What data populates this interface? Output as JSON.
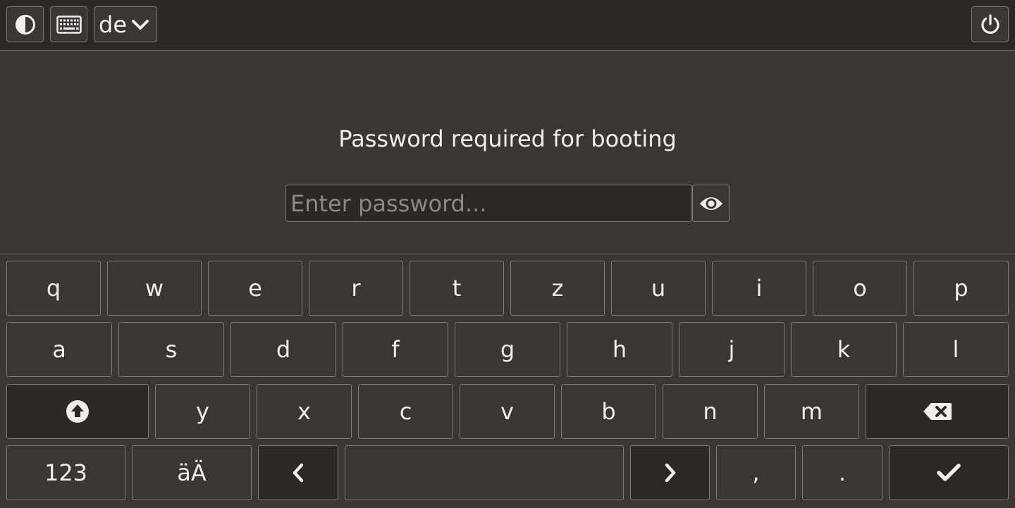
{
  "topbar": {
    "contrast_icon": "contrast-icon",
    "keyboard_icon": "keyboard-icon",
    "language": "de",
    "language_dropdown_icon": "chevron-down-icon",
    "power_icon": "power-icon"
  },
  "prompt": {
    "title": "Password required for booting",
    "password_placeholder": "Enter password...",
    "password_value": "",
    "reveal_icon": "eye-icon"
  },
  "keyboard": {
    "row1": [
      "q",
      "w",
      "e",
      "r",
      "t",
      "z",
      "u",
      "i",
      "o",
      "p"
    ],
    "row2": [
      "a",
      "s",
      "d",
      "f",
      "g",
      "h",
      "j",
      "k",
      "l"
    ],
    "row3": [
      "y",
      "x",
      "c",
      "v",
      "b",
      "n",
      "m"
    ],
    "shift_icon": "shift-icon",
    "backspace_icon": "backspace-icon",
    "numbers_label": "123",
    "umlaut_label": "äÄ",
    "left_icon": "chevron-left-icon",
    "right_icon": "chevron-right-icon",
    "comma": ",",
    "period": ".",
    "enter_icon": "checkmark-icon"
  },
  "colors": {
    "background": "#3b3632",
    "dark_surface": "#2c2825",
    "border": "#817a73",
    "text": "#f2efea",
    "placeholder": "#8e8883"
  }
}
